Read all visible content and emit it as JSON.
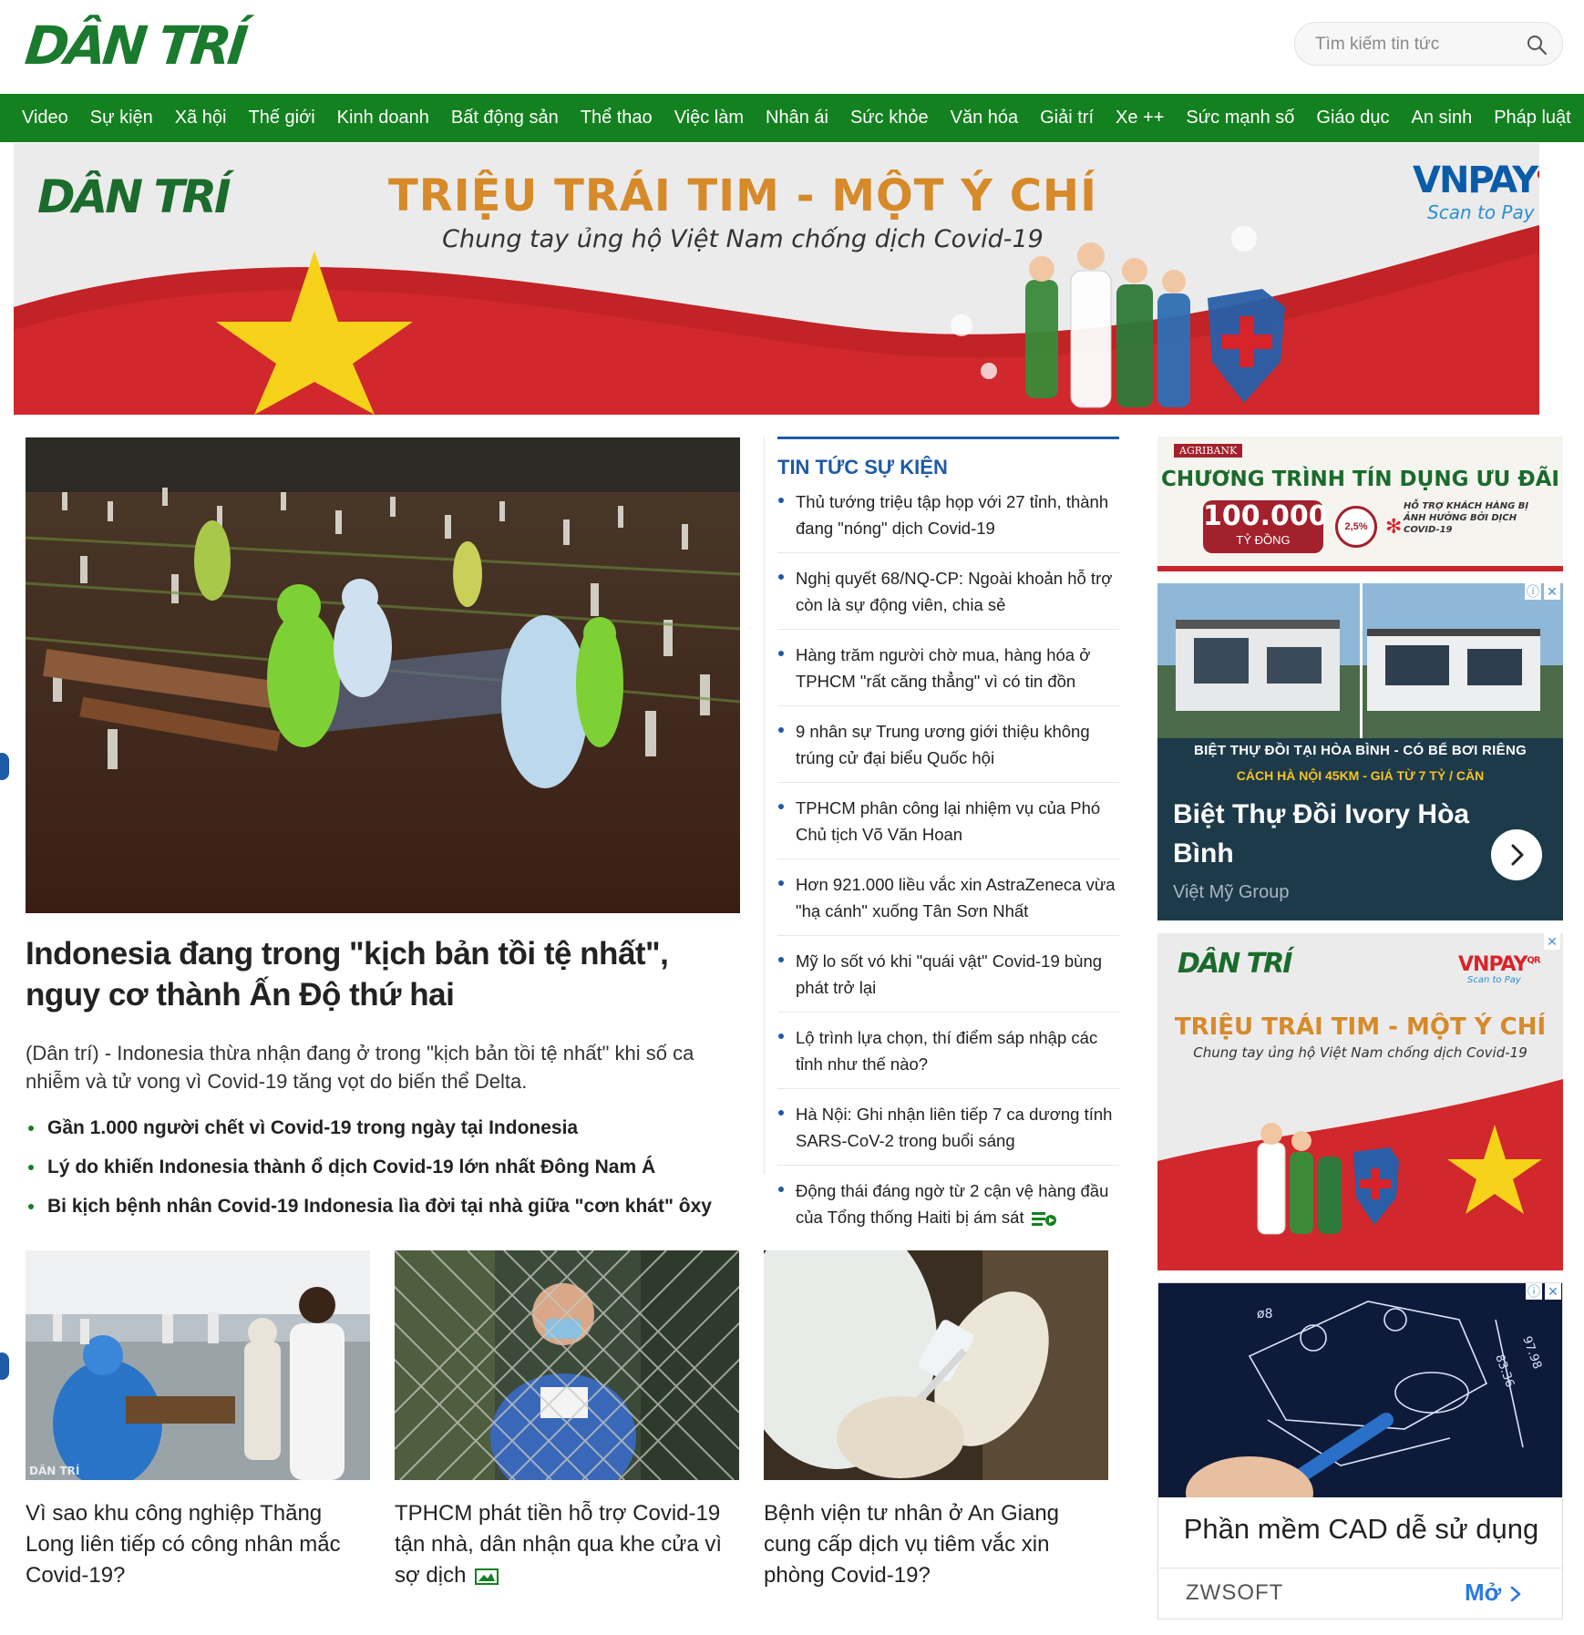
{
  "header": {
    "logo": "DÂN TRÍ",
    "search_placeholder": "Tìm kiếm tin tức"
  },
  "nav": [
    "Video",
    "Sự kiện",
    "Xã hội",
    "Thế giới",
    "Kinh doanh",
    "Bất động sản",
    "Thể thao",
    "Việc làm",
    "Nhân ái",
    "Sức khỏe",
    "Văn hóa",
    "Giải trí",
    "Xe ++",
    "Sức mạnh số",
    "Giáo dục",
    "An sinh",
    "Pháp luật"
  ],
  "banner": {
    "logo": "DÂN TRÍ",
    "title": "TRIỆU TRÁI TIM - MỘT Ý CHÍ",
    "subtitle": "Chung tay ủng hộ Việt Nam chống dịch Covid-19",
    "vnpay": "VNPAY",
    "vnpay_qr": "QR",
    "vnpay_sub": "Scan to Pay"
  },
  "feature": {
    "title": "Indonesia đang trong \"kịch bản tồi tệ nhất\", nguy cơ thành Ấn Độ thứ hai",
    "sapo": "(Dân trí) - Indonesia thừa nhận đang ở trong \"kịch bản tồi tệ nhất\" khi số ca nhiễm và tử vong vì Covid-19 tăng vọt do biến thể Delta.",
    "related": [
      "Gần 1.000 người chết vì Covid-19 trong ngày tại Indonesia",
      "Lý do khiến Indonesia thành ổ dịch Covid-19 lớn nhất Đông Nam Á",
      "Bi kịch bệnh nhân Covid-19 Indonesia lìa đời tại nhà giữa \"cơn khát\" ôxy"
    ]
  },
  "events": {
    "heading": "TIN TỨC SỰ KIỆN",
    "items": [
      "Thủ tướng triệu tập họp với 27 tỉnh, thành đang \"nóng\" dịch Covid-19",
      "Nghị quyết 68/NQ-CP: Ngoài khoản hỗ trợ còn là sự động viên, chia sẻ",
      "Hàng trăm người chờ mua, hàng hóa ở TPHCM \"rất căng thẳng\" vì có tin đồn",
      "9 nhân sự Trung ương giới thiệu không trúng cử đại biểu Quốc hội",
      "TPHCM phân công lại nhiệm vụ của Phó Chủ tịch Võ Văn Hoan",
      "Hơn 921.000 liều vắc xin AstraZeneca vừa \"hạ cánh\" xuống Tân Sơn Nhất",
      "Mỹ lo sốt vó khi \"quái vật\" Covid-19 bùng phát trở lại",
      "Lộ trình lựa chọn, thí điểm sáp nhập các tỉnh như thế nào?",
      "Hà Nội: Ghi nhận liên tiếp 7 ca dương tính SARS-CoV-2 trong buổi sáng",
      "Động thái đáng ngờ từ 2 cận vệ hàng đầu của Tổng thống Haiti bị ám sát"
    ]
  },
  "cards": [
    {
      "title": "Vì sao khu công nghiệp Thăng Long liên tiếp có công nhân mắc Covid-19?",
      "watermark": "DÂN TRÍ"
    },
    {
      "title": "TPHCM phát tiền hỗ trợ Covid-19 tận nhà, dân nhận qua khe cửa vì sợ dịch"
    },
    {
      "title": "Bệnh viện tư nhân ở An Giang cung cấp dịch vụ tiêm vắc xin phòng Covid-19?"
    }
  ],
  "ads": {
    "agribank": {
      "tag": "AGRIBANK",
      "title": "CHƯƠNG TRÌNH TÍN DỤNG ƯU ĐÃI",
      "amount": "100.000",
      "unit": "TỶ ĐỒNG",
      "rate": "2,5%",
      "note": "HỖ TRỢ KHÁCH HÀNG BỊ ẢNH HƯỞNG BỞI DỊCH COVID-19"
    },
    "villa": {
      "caption1": "BIỆT THỰ ĐỒI TẠI HÒA BÌNH - CÓ BỂ BƠI RIÊNG",
      "caption2": "CÁCH HÀ NỘI 45KM - GIÁ TỪ 7 TỶ / CĂN",
      "title": "Biệt Thự Đồi Ivory Hòa Bình",
      "brand": "Việt Mỹ Group"
    },
    "dantri": {
      "logo": "DÂN TRÍ",
      "vnpay": "VNPAY",
      "vnpay_qr": "QR",
      "vnpay_sub": "Scan to Pay",
      "title": "TRIỆU TRÁI TIM - MỘT Ý CHÍ",
      "subtitle": "Chung tay ủng hộ Việt Nam chống dịch Covid-19"
    },
    "cad": {
      "dim1": "ø8",
      "dim2": "83.36",
      "dim3": "97.98",
      "title": "Phần mềm CAD dễ sử dụng",
      "brand": "ZWSOFT",
      "open": "Mở"
    }
  },
  "colors": {
    "brand_green": "#13811f",
    "event_blue": "#1f5aa6",
    "banner_orange": "#d68a2a"
  }
}
